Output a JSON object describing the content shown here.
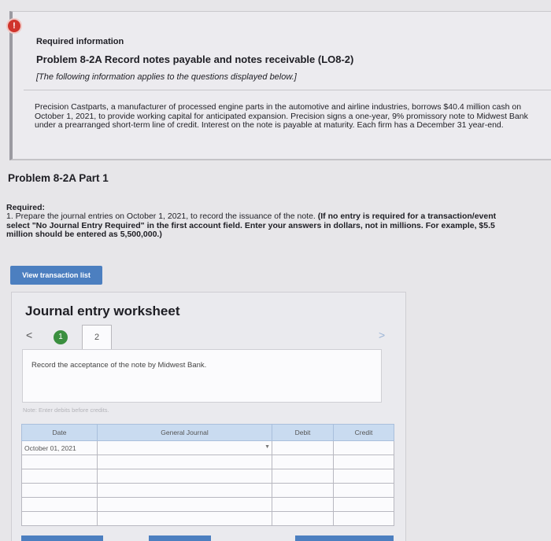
{
  "required_info": {
    "label": "Required information",
    "problem_title": "Problem 8-2A Record notes payable and notes receivable (LO8-2)",
    "note": "[The following information applies to the questions displayed below.]",
    "scenario": "Precision Castparts, a manufacturer of processed engine parts in the automotive and airline industries, borrows $40.4 million cash on October 1, 2021, to provide working capital for anticipated expansion. Precision signs a one-year, 9% promissory note to Midwest Bank under a prearranged short-term line of credit. Interest on the note is payable at maturity. Each firm has a December 31 year-end."
  },
  "part": {
    "title": "Problem 8-2A Part 1",
    "required_label": "Required:",
    "instruction_line1_plain": "1. Prepare the journal entries on October 1, 2021, to record the issuance of the note. ",
    "instruction_line1_bold": "(If no entry is required for a transaction/event",
    "instruction_line2": "select \"No Journal Entry Required\" in the first account field. Enter your answers in dollars, not in millions. For example, $5.5",
    "instruction_line3": "million should be entered as 5,500,000.)"
  },
  "buttons": {
    "view_transaction_list": "View transaction list"
  },
  "worksheet": {
    "title": "Journal entry worksheet",
    "prev_icon": "<",
    "next_icon": ">",
    "step_1": "1",
    "step_2": "2",
    "description": "Record the acceptance of the note by Midwest Bank.",
    "note": "Note: Enter debits before credits.",
    "columns": [
      "Date",
      "General Journal",
      "Debit",
      "Credit"
    ],
    "rows": [
      {
        "date": "October 01, 2021",
        "account": "",
        "debit": "",
        "credit": ""
      },
      {
        "date": "",
        "account": "",
        "debit": "",
        "credit": ""
      },
      {
        "date": "",
        "account": "",
        "debit": "",
        "credit": ""
      },
      {
        "date": "",
        "account": "",
        "debit": "",
        "credit": ""
      },
      {
        "date": "",
        "account": "",
        "debit": "",
        "credit": ""
      },
      {
        "date": "",
        "account": "",
        "debit": "",
        "credit": ""
      }
    ]
  },
  "colors": {
    "button_blue": "#4c7fc0",
    "header_blue": "#c9dbf0",
    "step_green": "#3a8f3f",
    "alert_red": "#d0342c"
  }
}
